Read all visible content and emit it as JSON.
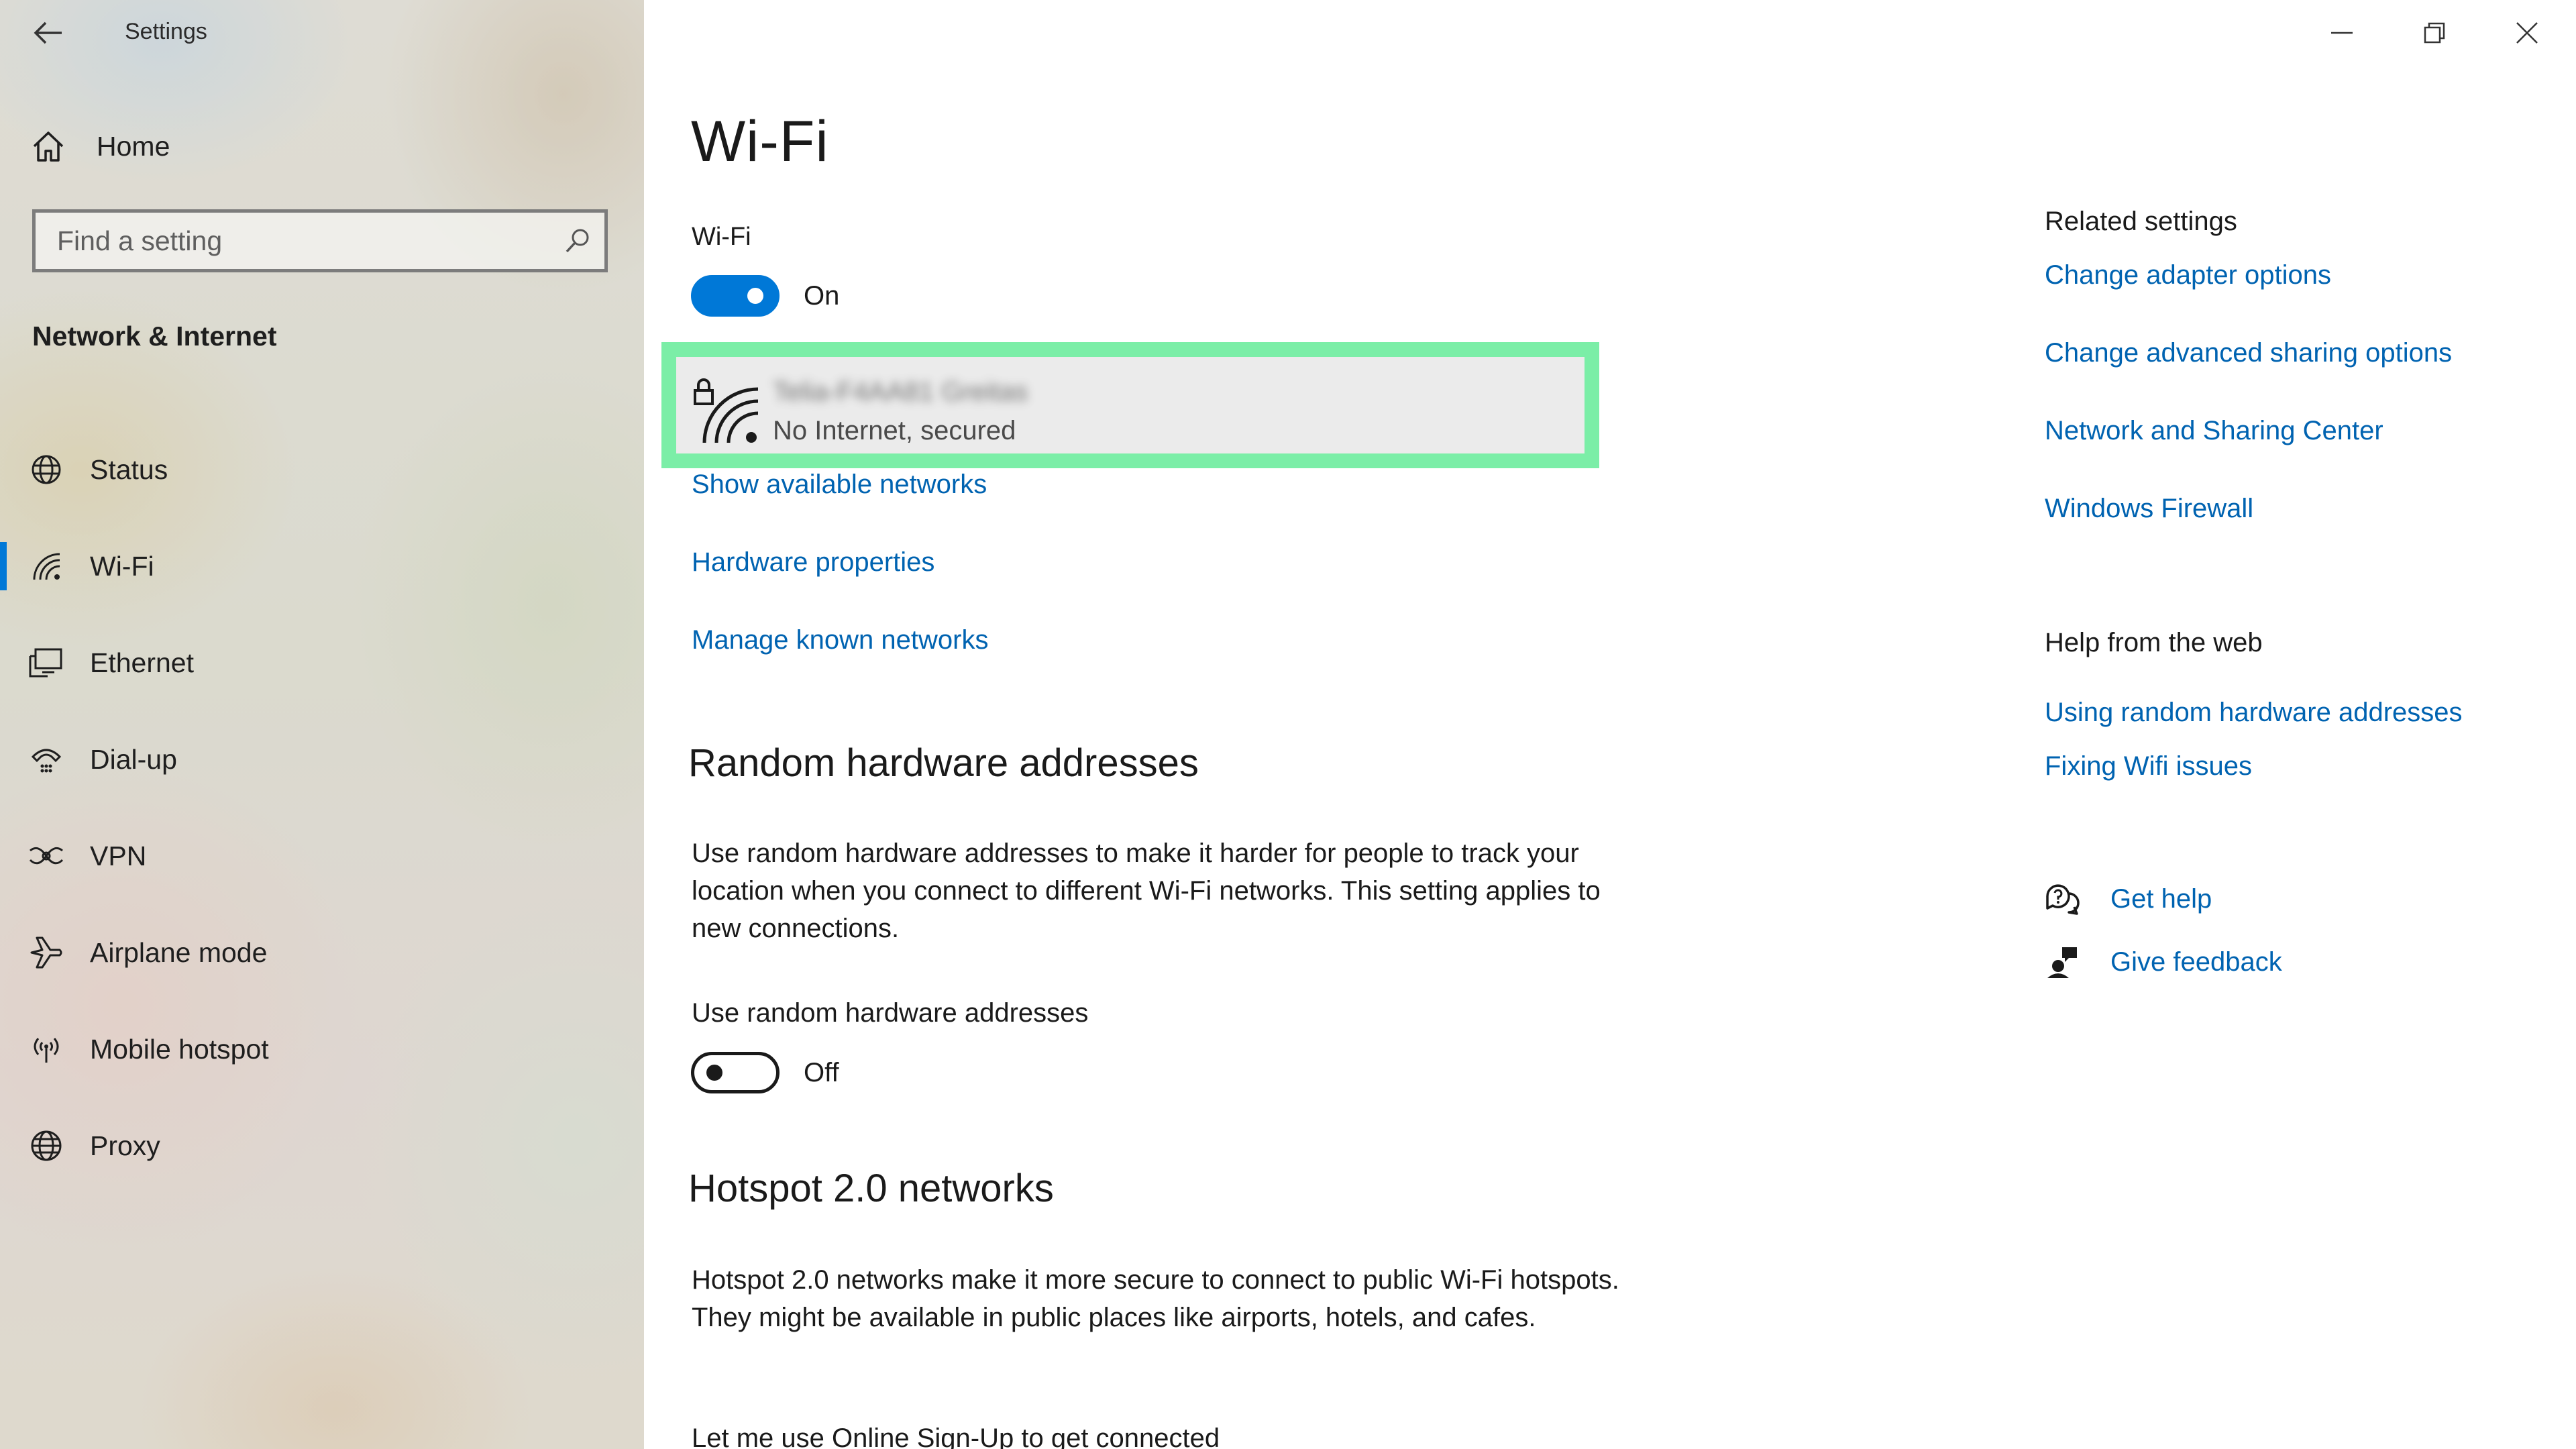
{
  "window": {
    "title": "Settings",
    "controls": [
      "minimize",
      "restore",
      "close"
    ]
  },
  "sidebar": {
    "home_label": "Home",
    "search_placeholder": "Find a setting",
    "section_title": "Network & Internet",
    "items": [
      {
        "label": "Status",
        "icon": "globe-status-icon"
      },
      {
        "label": "Wi-Fi",
        "icon": "wifi-icon",
        "selected": true
      },
      {
        "label": "Ethernet",
        "icon": "ethernet-icon"
      },
      {
        "label": "Dial-up",
        "icon": "dialup-icon"
      },
      {
        "label": "VPN",
        "icon": "vpn-icon"
      },
      {
        "label": "Airplane mode",
        "icon": "airplane-icon"
      },
      {
        "label": "Mobile hotspot",
        "icon": "hotspot-icon"
      },
      {
        "label": "Proxy",
        "icon": "globe-icon"
      }
    ]
  },
  "main": {
    "page_title": "Wi-Fi",
    "wifi_toggle": {
      "label": "Wi-Fi",
      "state": "On",
      "on": true
    },
    "network": {
      "name": "Telia-F4AA81 Greitas",
      "status": "No Internet, secured",
      "highlight_color": "#7beea7"
    },
    "links": {
      "show_networks": "Show available networks",
      "hardware_properties": "Hardware properties",
      "manage_known": "Manage known networks"
    },
    "random_hw": {
      "heading": "Random hardware addresses",
      "description": "Use random hardware addresses to make it harder for people to track your location when you connect to different Wi-Fi networks. This setting applies to new connections.",
      "toggle_label": "Use random hardware addresses",
      "state": "Off",
      "on": false
    },
    "hotspot": {
      "heading": "Hotspot 2.0 networks",
      "description": "Hotspot 2.0 networks make it more secure to connect to public Wi-Fi hotspots. They might be available in public places like airports, hotels, and cafes.",
      "signup_text": "Let me use Online Sign-Up to get connected"
    }
  },
  "related": {
    "title": "Related settings",
    "links": [
      "Change adapter options",
      "Change advanced sharing options",
      "Network and Sharing Center",
      "Windows Firewall"
    ]
  },
  "help": {
    "title": "Help from the web",
    "links": [
      "Using random hardware addresses",
      "Fixing Wifi issues"
    ]
  },
  "support": {
    "get_help": "Get help",
    "give_feedback": "Give feedback"
  },
  "colors": {
    "accent": "#0078d7",
    "link": "#0063b1",
    "highlight": "#7beea7"
  }
}
